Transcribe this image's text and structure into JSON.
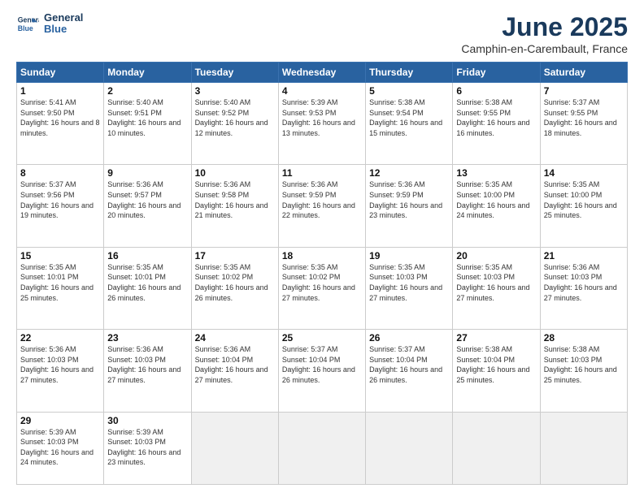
{
  "logo": {
    "line1": "General",
    "line2": "Blue"
  },
  "title": "June 2025",
  "subtitle": "Camphin-en-Carembault, France",
  "weekdays": [
    "Sunday",
    "Monday",
    "Tuesday",
    "Wednesday",
    "Thursday",
    "Friday",
    "Saturday"
  ],
  "weeks": [
    [
      {
        "day": "1",
        "sunrise": "Sunrise: 5:41 AM",
        "sunset": "Sunset: 9:50 PM",
        "daylight": "Daylight: 16 hours and 8 minutes."
      },
      {
        "day": "2",
        "sunrise": "Sunrise: 5:40 AM",
        "sunset": "Sunset: 9:51 PM",
        "daylight": "Daylight: 16 hours and 10 minutes."
      },
      {
        "day": "3",
        "sunrise": "Sunrise: 5:40 AM",
        "sunset": "Sunset: 9:52 PM",
        "daylight": "Daylight: 16 hours and 12 minutes."
      },
      {
        "day": "4",
        "sunrise": "Sunrise: 5:39 AM",
        "sunset": "Sunset: 9:53 PM",
        "daylight": "Daylight: 16 hours and 13 minutes."
      },
      {
        "day": "5",
        "sunrise": "Sunrise: 5:38 AM",
        "sunset": "Sunset: 9:54 PM",
        "daylight": "Daylight: 16 hours and 15 minutes."
      },
      {
        "day": "6",
        "sunrise": "Sunrise: 5:38 AM",
        "sunset": "Sunset: 9:55 PM",
        "daylight": "Daylight: 16 hours and 16 minutes."
      },
      {
        "day": "7",
        "sunrise": "Sunrise: 5:37 AM",
        "sunset": "Sunset: 9:55 PM",
        "daylight": "Daylight: 16 hours and 18 minutes."
      }
    ],
    [
      {
        "day": "8",
        "sunrise": "Sunrise: 5:37 AM",
        "sunset": "Sunset: 9:56 PM",
        "daylight": "Daylight: 16 hours and 19 minutes."
      },
      {
        "day": "9",
        "sunrise": "Sunrise: 5:36 AM",
        "sunset": "Sunset: 9:57 PM",
        "daylight": "Daylight: 16 hours and 20 minutes."
      },
      {
        "day": "10",
        "sunrise": "Sunrise: 5:36 AM",
        "sunset": "Sunset: 9:58 PM",
        "daylight": "Daylight: 16 hours and 21 minutes."
      },
      {
        "day": "11",
        "sunrise": "Sunrise: 5:36 AM",
        "sunset": "Sunset: 9:59 PM",
        "daylight": "Daylight: 16 hours and 22 minutes."
      },
      {
        "day": "12",
        "sunrise": "Sunrise: 5:36 AM",
        "sunset": "Sunset: 9:59 PM",
        "daylight": "Daylight: 16 hours and 23 minutes."
      },
      {
        "day": "13",
        "sunrise": "Sunrise: 5:35 AM",
        "sunset": "Sunset: 10:00 PM",
        "daylight": "Daylight: 16 hours and 24 minutes."
      },
      {
        "day": "14",
        "sunrise": "Sunrise: 5:35 AM",
        "sunset": "Sunset: 10:00 PM",
        "daylight": "Daylight: 16 hours and 25 minutes."
      }
    ],
    [
      {
        "day": "15",
        "sunrise": "Sunrise: 5:35 AM",
        "sunset": "Sunset: 10:01 PM",
        "daylight": "Daylight: 16 hours and 25 minutes."
      },
      {
        "day": "16",
        "sunrise": "Sunrise: 5:35 AM",
        "sunset": "Sunset: 10:01 PM",
        "daylight": "Daylight: 16 hours and 26 minutes."
      },
      {
        "day": "17",
        "sunrise": "Sunrise: 5:35 AM",
        "sunset": "Sunset: 10:02 PM",
        "daylight": "Daylight: 16 hours and 26 minutes."
      },
      {
        "day": "18",
        "sunrise": "Sunrise: 5:35 AM",
        "sunset": "Sunset: 10:02 PM",
        "daylight": "Daylight: 16 hours and 27 minutes."
      },
      {
        "day": "19",
        "sunrise": "Sunrise: 5:35 AM",
        "sunset": "Sunset: 10:03 PM",
        "daylight": "Daylight: 16 hours and 27 minutes."
      },
      {
        "day": "20",
        "sunrise": "Sunrise: 5:35 AM",
        "sunset": "Sunset: 10:03 PM",
        "daylight": "Daylight: 16 hours and 27 minutes."
      },
      {
        "day": "21",
        "sunrise": "Sunrise: 5:36 AM",
        "sunset": "Sunset: 10:03 PM",
        "daylight": "Daylight: 16 hours and 27 minutes."
      }
    ],
    [
      {
        "day": "22",
        "sunrise": "Sunrise: 5:36 AM",
        "sunset": "Sunset: 10:03 PM",
        "daylight": "Daylight: 16 hours and 27 minutes."
      },
      {
        "day": "23",
        "sunrise": "Sunrise: 5:36 AM",
        "sunset": "Sunset: 10:03 PM",
        "daylight": "Daylight: 16 hours and 27 minutes."
      },
      {
        "day": "24",
        "sunrise": "Sunrise: 5:36 AM",
        "sunset": "Sunset: 10:04 PM",
        "daylight": "Daylight: 16 hours and 27 minutes."
      },
      {
        "day": "25",
        "sunrise": "Sunrise: 5:37 AM",
        "sunset": "Sunset: 10:04 PM",
        "daylight": "Daylight: 16 hours and 26 minutes."
      },
      {
        "day": "26",
        "sunrise": "Sunrise: 5:37 AM",
        "sunset": "Sunset: 10:04 PM",
        "daylight": "Daylight: 16 hours and 26 minutes."
      },
      {
        "day": "27",
        "sunrise": "Sunrise: 5:38 AM",
        "sunset": "Sunset: 10:04 PM",
        "daylight": "Daylight: 16 hours and 25 minutes."
      },
      {
        "day": "28",
        "sunrise": "Sunrise: 5:38 AM",
        "sunset": "Sunset: 10:03 PM",
        "daylight": "Daylight: 16 hours and 25 minutes."
      }
    ],
    [
      {
        "day": "29",
        "sunrise": "Sunrise: 5:39 AM",
        "sunset": "Sunset: 10:03 PM",
        "daylight": "Daylight: 16 hours and 24 minutes."
      },
      {
        "day": "30",
        "sunrise": "Sunrise: 5:39 AM",
        "sunset": "Sunset: 10:03 PM",
        "daylight": "Daylight: 16 hours and 23 minutes."
      },
      null,
      null,
      null,
      null,
      null
    ]
  ]
}
